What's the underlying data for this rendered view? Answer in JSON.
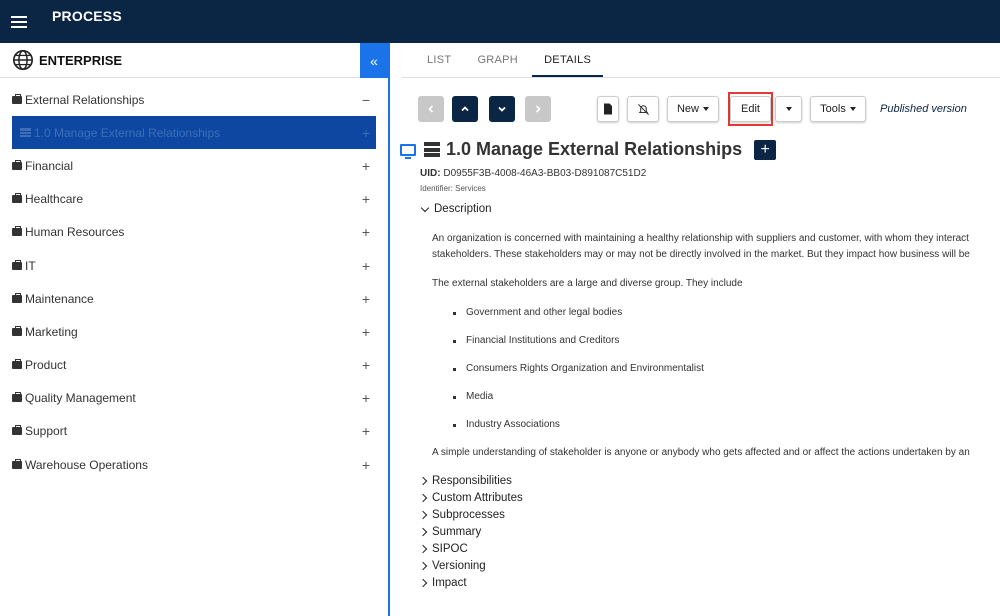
{
  "app": {
    "title": "PROCESS"
  },
  "sidebar": {
    "header": "ENTERPRISE",
    "collapse_glyph": "«",
    "items": [
      {
        "label": "External Relationships",
        "toggle": "−"
      },
      {
        "label": "1.0 Manage External Relationships",
        "toggle": "+"
      },
      {
        "label": "Financial",
        "toggle": "+"
      },
      {
        "label": "Healthcare",
        "toggle": "+"
      },
      {
        "label": "Human Resources",
        "toggle": "+"
      },
      {
        "label": "IT",
        "toggle": "+"
      },
      {
        "label": "Maintenance",
        "toggle": "+"
      },
      {
        "label": "Marketing",
        "toggle": "+"
      },
      {
        "label": "Product",
        "toggle": "+"
      },
      {
        "label": "Quality Management",
        "toggle": "+"
      },
      {
        "label": "Support",
        "toggle": "+"
      },
      {
        "label": "Warehouse Operations",
        "toggle": "+"
      }
    ]
  },
  "tabs": [
    {
      "label": "LIST"
    },
    {
      "label": "GRAPH"
    },
    {
      "label": "DETAILS"
    }
  ],
  "toolbar": {
    "new_label": "New",
    "edit_label": "Edit",
    "tools_label": "Tools",
    "published": "Published version"
  },
  "detail": {
    "title": "1.0 Manage External Relationships",
    "uid_label": "UID:",
    "uid_value": "D0955F3B-4008-46A3-BB03-D891087C51D2",
    "identifier": "Identifier:  Services",
    "description_label": "Description",
    "para1_line1": "An organization is concerned with maintaining a healthy relationship with suppliers and customer, with whom they interact",
    "para1_line2": "stakeholders. These stakeholders may or may not be directly involved in the market. But they impact how business will be",
    "para2": "The external stakeholders are a large and diverse group. They include",
    "bullets": [
      "Government and other legal bodies",
      "Financial Institutions and Creditors",
      "Consumers Rights Organization and Environmentalist",
      "Media",
      "Industry Associations"
    ],
    "para3": "A simple understanding of stakeholder is anyone or anybody who gets affected and or affect the actions undertaken by an",
    "sections": [
      "Responsibilities",
      "Custom Attributes",
      "Subprocesses",
      "Summary",
      "SIPOC",
      "Versioning",
      "Impact"
    ]
  },
  "colors": {
    "topbar": "#0b2545",
    "accent": "#1a73e8",
    "selected": "#0d47a1",
    "highlight": "#e53935"
  }
}
